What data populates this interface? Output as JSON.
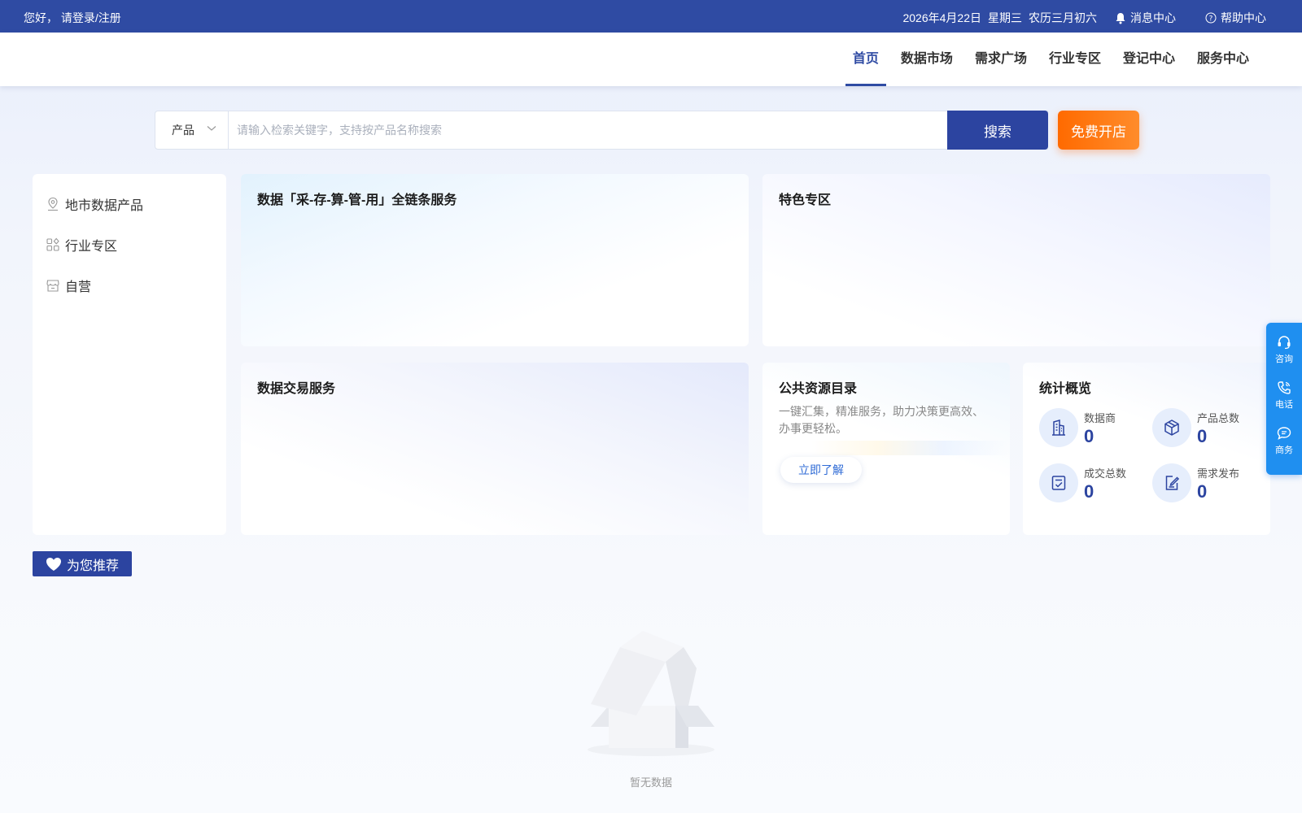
{
  "topbar": {
    "greeting": "您好，",
    "login": "请登录/注册",
    "date": "2026年4月22日",
    "weekday": "星期三",
    "lunar": "农历三月初六",
    "messages": "消息中心",
    "help": "帮助中心"
  },
  "nav": {
    "items": [
      "首页",
      "数据市场",
      "需求广场",
      "行业专区",
      "登记中心",
      "服务中心"
    ],
    "active_index": 0,
    "active_color": "#2f4ba3"
  },
  "search": {
    "category": "产品",
    "placeholder": "请输入检索关键字，支持按产品名称搜索",
    "value": "",
    "button": "搜索",
    "shop_button": "免费开店"
  },
  "sidebar": {
    "items": [
      {
        "label": "地市数据产品",
        "icon": "location-pin-icon"
      },
      {
        "label": "行业专区",
        "icon": "grid-apps-icon"
      },
      {
        "label": "自营",
        "icon": "store-icon"
      }
    ]
  },
  "cards": {
    "chain": {
      "title": "数据「采-存-算-管-用」全链条服务"
    },
    "feature": {
      "title": "特色专区"
    },
    "trade": {
      "title": "数据交易服务"
    },
    "public": {
      "title": "公共资源目录",
      "description": "一键汇集，精准服务，助力决策更高效、办事更轻松。",
      "button": "立即了解"
    },
    "stats": {
      "title": "统计概览",
      "items": [
        {
          "label": "数据商",
          "value": "0",
          "icon": "building-icon"
        },
        {
          "label": "产品总数",
          "value": "0",
          "icon": "cube-icon"
        },
        {
          "label": "成交总数",
          "value": "0",
          "icon": "checklist-icon"
        },
        {
          "label": "需求发布",
          "value": "0",
          "icon": "edit-doc-icon"
        }
      ]
    }
  },
  "recommend": {
    "label": "为您推荐",
    "icon": "heart-icon"
  },
  "empty": {
    "text": "暂无数据"
  },
  "float_bar": {
    "items": [
      {
        "label": "咨询",
        "icon": "headset-icon"
      },
      {
        "label": "电话",
        "icon": "phone-icon"
      },
      {
        "label": "商务",
        "icon": "chat-icon"
      }
    ],
    "color": "#1f8ff0"
  }
}
